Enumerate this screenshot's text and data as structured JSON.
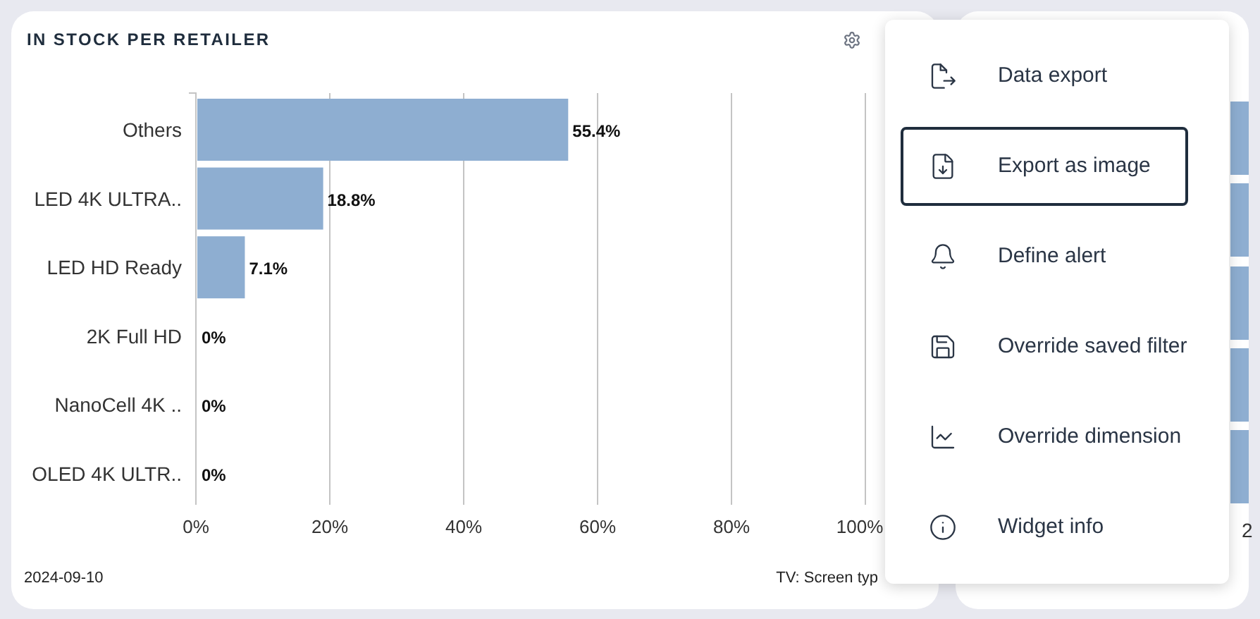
{
  "widget": {
    "title": "IN STOCK PER RETAILER",
    "chart_data": {
      "type": "bar",
      "orientation": "horizontal",
      "categories": [
        "Others",
        "LED 4K ULTRA..",
        "LED HD Ready",
        "2K Full HD",
        "NanoCell 4K ..",
        "OLED 4K ULTR.."
      ],
      "series": [
        {
          "color": "#8eaed1",
          "values": [
            55.4,
            18.8,
            7.1,
            0,
            0,
            0
          ]
        }
      ],
      "grid": true,
      "value_labels": [
        "55.4%",
        "18.8%",
        "7.1%",
        "0%",
        "0%",
        "0%"
      ],
      "xlim": [
        0,
        100
      ],
      "xticks": [
        {
          "value": 0,
          "label": "0%"
        },
        {
          "value": 20,
          "label": "20%"
        },
        {
          "value": 40,
          "label": "40%"
        },
        {
          "value": 60,
          "label": "60%"
        },
        {
          "value": 80,
          "label": "80%"
        },
        {
          "value": 100,
          "label": "100%"
        }
      ]
    },
    "footer_date": "2024-09-10",
    "footer_dimension": "TV: Screen typ"
  },
  "second_widget": {
    "tick_label": "2"
  },
  "menu": {
    "items": [
      {
        "label": "Data export",
        "kind": "export",
        "selected": false
      },
      {
        "label": "Export as image",
        "kind": "image",
        "selected": true
      },
      {
        "label": "Define alert",
        "kind": "alert",
        "selected": false
      },
      {
        "label": "Override saved filter",
        "kind": "filter",
        "selected": false
      },
      {
        "label": "Override dimension",
        "kind": "dimension",
        "selected": false
      },
      {
        "label": "Widget info",
        "kind": "info",
        "selected": false
      }
    ]
  }
}
